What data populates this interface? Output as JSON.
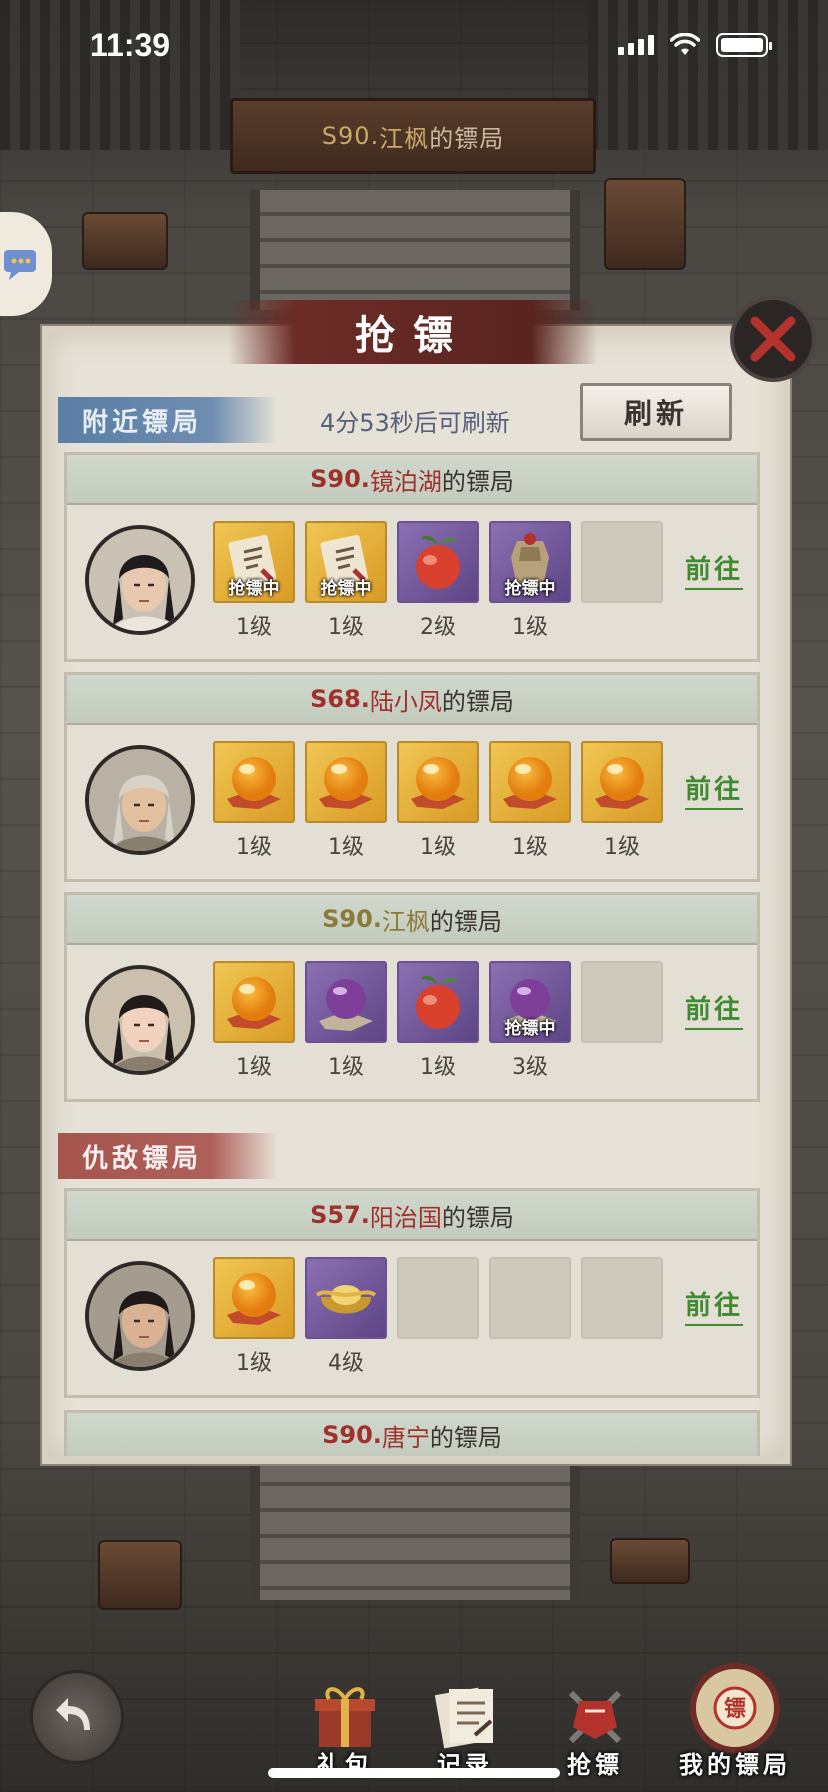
{
  "status_bar": {
    "time": "11:39"
  },
  "top_sign": {
    "server": "S90.",
    "name": "江枫",
    "suffix": "的镖局"
  },
  "panel": {
    "title": "抢镖",
    "nearby_tag": "附近镖局",
    "refresh_countdown": "4分53秒后可刷新",
    "refresh_button": "刷新",
    "enemy_tag": "仇敌镖局",
    "goto_label": "前往",
    "robbing_label": "抢镖中"
  },
  "cards": [
    {
      "server": "S90.",
      "name": "镜泊湖",
      "suffix": "的镖局",
      "name_color": "red",
      "slots": [
        {
          "kind": "gold",
          "icon": "scroll-icon",
          "level": "1级",
          "robbing": true
        },
        {
          "kind": "gold",
          "icon": "scroll-icon",
          "level": "1级",
          "robbing": true
        },
        {
          "kind": "purple",
          "icon": "peach-icon",
          "level": "2级",
          "robbing": false
        },
        {
          "kind": "purple",
          "icon": "armor-icon",
          "level": "1级",
          "robbing": true
        },
        {
          "kind": "empty",
          "icon": "",
          "level": "",
          "robbing": false
        }
      ]
    },
    {
      "server": "S68.",
      "name": "陆小凤",
      "suffix": "的镖局",
      "name_color": "red",
      "slots": [
        {
          "kind": "gold",
          "icon": "orb-icon",
          "level": "1级",
          "robbing": false
        },
        {
          "kind": "gold",
          "icon": "orb-icon",
          "level": "1级",
          "robbing": false
        },
        {
          "kind": "gold",
          "icon": "orb-icon",
          "level": "1级",
          "robbing": false
        },
        {
          "kind": "gold",
          "icon": "orb-icon",
          "level": "1级",
          "robbing": false
        },
        {
          "kind": "gold",
          "icon": "orb-icon",
          "level": "1级",
          "robbing": false
        }
      ]
    },
    {
      "server": "S90.",
      "name": "江枫",
      "suffix": "的镖局",
      "name_color": "gold",
      "slots": [
        {
          "kind": "gold",
          "icon": "orb-icon",
          "level": "1级",
          "robbing": false
        },
        {
          "kind": "purple",
          "icon": "purple-orb-icon",
          "level": "1级",
          "robbing": false
        },
        {
          "kind": "purple",
          "icon": "peach-icon",
          "level": "1级",
          "robbing": false
        },
        {
          "kind": "purple",
          "icon": "purple-orb-icon",
          "level": "3级",
          "robbing": true
        },
        {
          "kind": "empty",
          "icon": "",
          "level": "",
          "robbing": false
        }
      ]
    },
    {
      "server": "S57.",
      "name": "阳治国",
      "suffix": "的镖局",
      "name_color": "red",
      "slots": [
        {
          "kind": "gold",
          "icon": "orb-icon",
          "level": "1级",
          "robbing": false
        },
        {
          "kind": "purple",
          "icon": "gold-ingot-icon",
          "level": "4级",
          "robbing": false
        },
        {
          "kind": "empty",
          "icon": "",
          "level": "",
          "robbing": false
        },
        {
          "kind": "empty",
          "icon": "",
          "level": "",
          "robbing": false
        },
        {
          "kind": "empty",
          "icon": "",
          "level": "",
          "robbing": false
        }
      ]
    }
  ],
  "partial_card": {
    "server": "S90.",
    "name": "唐宁",
    "suffix": "的镖局"
  },
  "bottom_nav": [
    {
      "label": "礼包",
      "icon": "gift-icon"
    },
    {
      "label": "记录",
      "icon": "record-icon"
    },
    {
      "label": "抢镖",
      "icon": "rob-icon"
    },
    {
      "label": "我的镖局",
      "icon": "my-agency-icon"
    }
  ],
  "colors": {
    "red_name": "#a0302c",
    "gold_name": "#8c7a3a",
    "goto_green": "#3f8a32",
    "title_band": "#6d2c27"
  }
}
